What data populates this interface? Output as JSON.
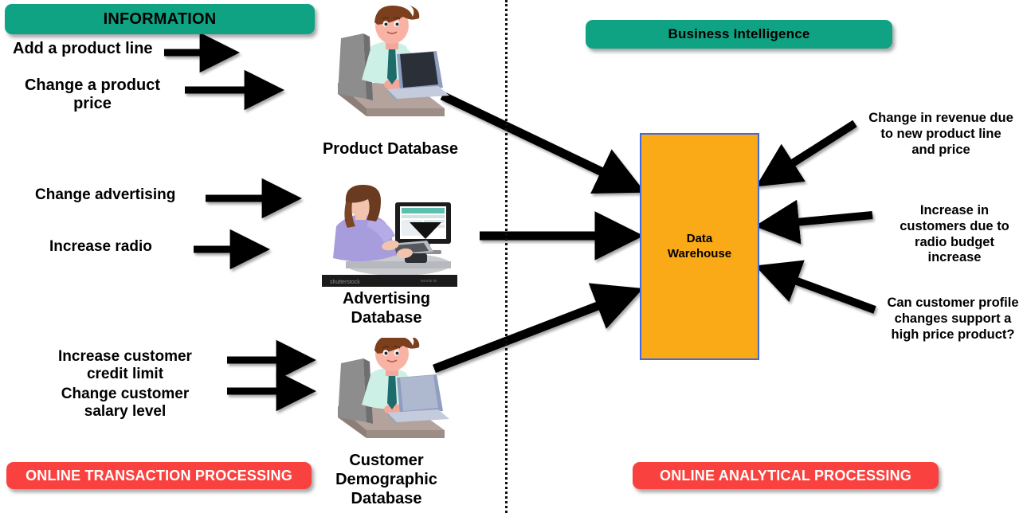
{
  "banners": {
    "information": {
      "label": "INFORMATION",
      "color": "#0FA383",
      "text_color": "#000000"
    },
    "business_intelligence": {
      "label": "Business Intelligence",
      "color": "#0FA383",
      "text_color": "#000000"
    },
    "oltp": {
      "label": "ONLINE TRANSACTION PROCESSING",
      "color": "#F9423F",
      "text_color": "#FFFFFF"
    },
    "olap": {
      "label": "ONLINE ANALYTICAL PROCESSING",
      "color": "#F9423F",
      "text_color": "#FFFFFF"
    }
  },
  "actions": {
    "add_product_line": "Add a product line",
    "change_product_price": "Change a product\nprice",
    "change_advertising": "Change advertising",
    "increase_radio": "Increase radio",
    "increase_credit_limit": "Increase customer\ncredit limit",
    "change_salary_level": "Change customer\nsalary level"
  },
  "databases": {
    "product": {
      "caption": "Product Database",
      "icon": "man-at-laptop-icon"
    },
    "advertising": {
      "caption": "Advertising\nDatabase",
      "icon": "woman-at-desktop-icon",
      "watermark": "shutterstock",
      "watermark_id": "IMAGE ID"
    },
    "customer": {
      "caption": "Customer\nDemographic\nDatabase",
      "icon": "man-at-laptop-icon"
    }
  },
  "warehouse": {
    "label": "Data\nWarehouse",
    "fill": "#FAA917",
    "border": "#4169E1"
  },
  "insights": {
    "revenue_change": "Change in revenue due\nto new product line\nand price",
    "customer_increase": "Increase in\ncustomers due to\nradio budget\nincrease",
    "customer_profile": "Can customer profile\nchanges support a\nhigh price product?"
  },
  "divider": {
    "style": "dotted-vertical",
    "color": "#111111"
  },
  "arrows": {
    "color": "#000000",
    "inbound_count": 3,
    "outbound_count": 3,
    "action_count": 6
  }
}
